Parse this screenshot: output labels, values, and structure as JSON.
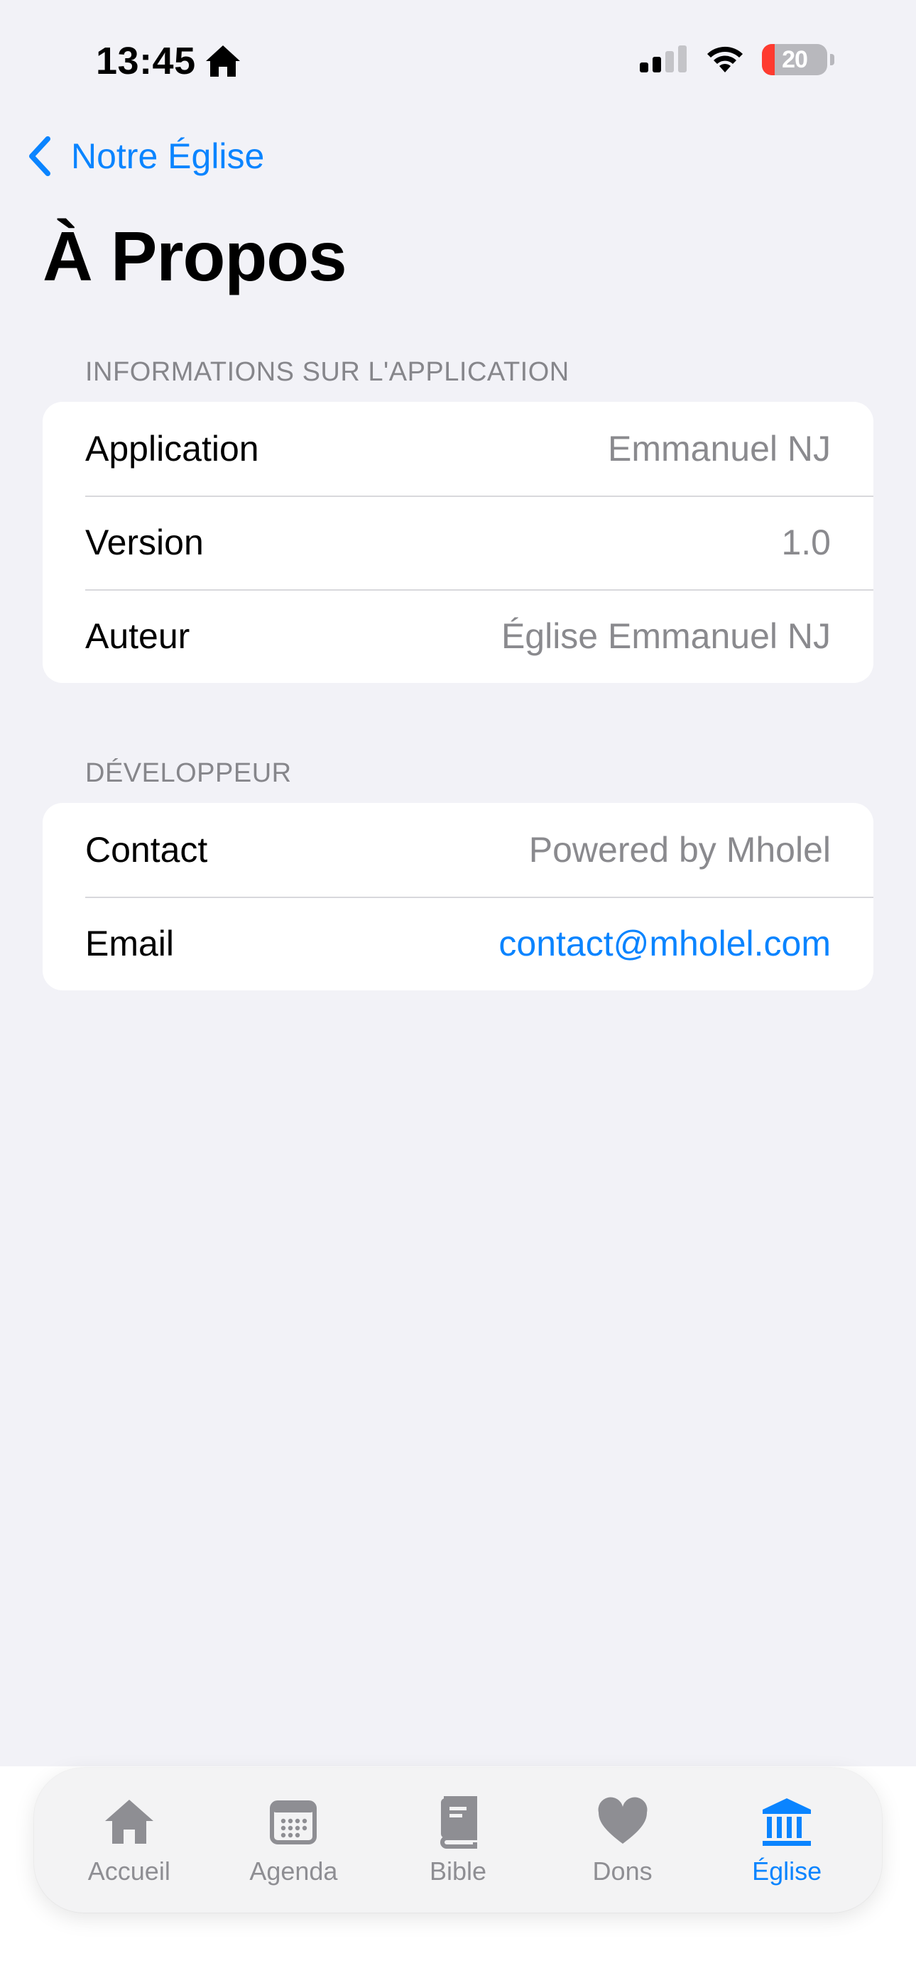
{
  "status_bar": {
    "time": "13:45",
    "battery": "20",
    "battery_level": 0.2
  },
  "nav": {
    "back_label": "Notre Église",
    "title": "À Propos"
  },
  "sections": [
    {
      "header": "INFORMATIONS SUR L'APPLICATION",
      "rows": [
        {
          "label": "Application",
          "value": "Emmanuel NJ"
        },
        {
          "label": "Version",
          "value": "1.0"
        },
        {
          "label": "Auteur",
          "value": "Église Emmanuel NJ"
        }
      ]
    },
    {
      "header": "DÉVELOPPEUR",
      "rows": [
        {
          "label": "Contact",
          "value": "Powered by Mholel"
        },
        {
          "label": "Email",
          "value": "contact@mholel.com"
        }
      ]
    }
  ],
  "tab_bar": {
    "items": [
      {
        "label": "Accueil",
        "icon": "house-icon"
      },
      {
        "label": "Agenda",
        "icon": "calendar-icon"
      },
      {
        "label": "Bible",
        "icon": "book-icon"
      },
      {
        "label": "Dons",
        "icon": "heart-icon"
      },
      {
        "label": "Église",
        "icon": "building-columns-icon"
      }
    ],
    "active_index": 4
  },
  "colors": {
    "accent": "#0a84ff",
    "background": "#f2f2f7",
    "secondary_text": "#8a8a8e",
    "battery_low": "#ff3b30"
  }
}
